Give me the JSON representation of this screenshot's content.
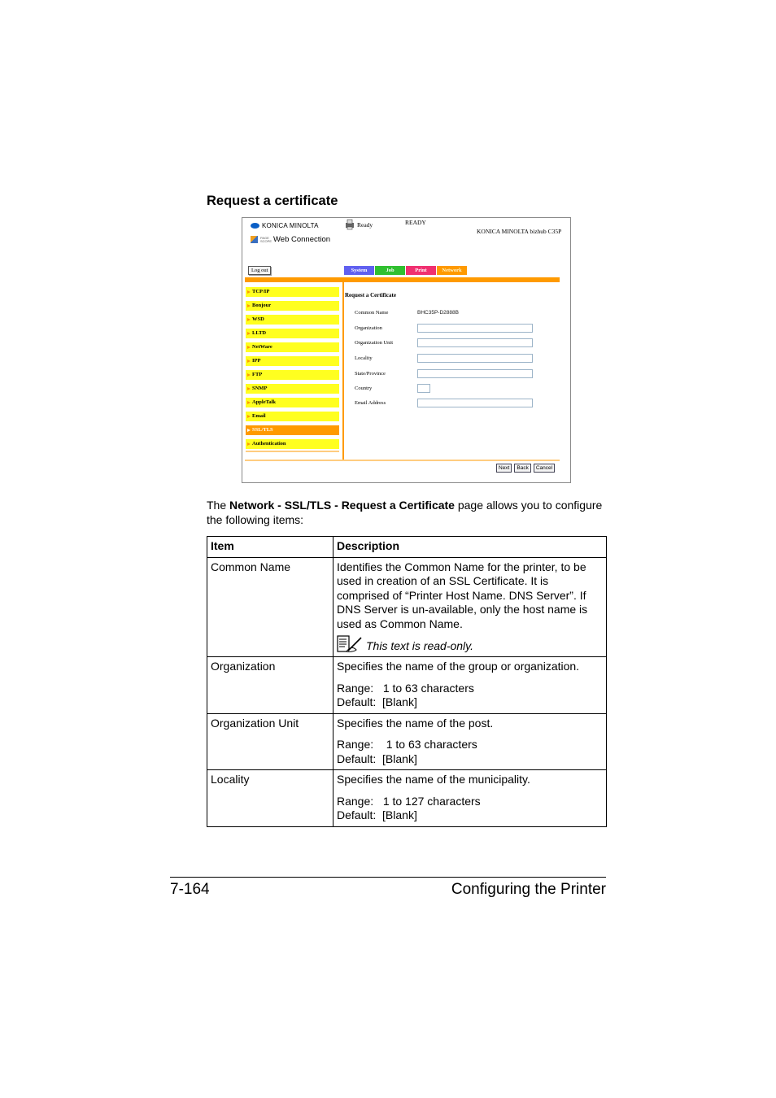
{
  "section_title": "Request a certificate",
  "screenshot": {
    "brand": "KONICA MINOLTA",
    "app_name": "Web Connection",
    "pagescope_label": "PAGE SCOPE",
    "status_label": "Ready",
    "status_value": "READY",
    "model_name": "KONICA MINOLTA bizhub C35P",
    "logout_label": "Log out",
    "tabs": [
      {
        "label": "System"
      },
      {
        "label": "Job"
      },
      {
        "label": "Print"
      },
      {
        "label": "Network"
      }
    ],
    "sidebar": [
      {
        "label": "TCP/IP"
      },
      {
        "label": "Bonjour"
      },
      {
        "label": "WSD"
      },
      {
        "label": "LLTD"
      },
      {
        "label": "NetWare"
      },
      {
        "label": "IPP"
      },
      {
        "label": "FTP"
      },
      {
        "label": "SNMP"
      },
      {
        "label": "AppleTalk"
      },
      {
        "label": "Email"
      },
      {
        "label": "SSL/TLS",
        "active": true
      },
      {
        "label": "Authentication"
      }
    ],
    "form": {
      "title": "Request a Certificate",
      "fields": [
        {
          "label": "Common Name",
          "value": "BHC35P-D2888B",
          "readonly": true
        },
        {
          "label": "Organization",
          "value": ""
        },
        {
          "label": "Organization Unit",
          "value": ""
        },
        {
          "label": "Locality",
          "value": ""
        },
        {
          "label": "State/Province",
          "value": ""
        },
        {
          "label": "Country",
          "value": ""
        },
        {
          "label": "Email Address",
          "value": ""
        }
      ]
    },
    "buttons": {
      "next": "Next",
      "back": "Back",
      "cancel": "Cancel"
    }
  },
  "intro": {
    "prefix": "The ",
    "bold": "Network - SSL/TLS - Request a Certificate",
    "suffix": " page allows you to configure the following items:"
  },
  "table": {
    "headers": [
      "Item",
      "Description"
    ],
    "rows": [
      {
        "item": "Common Name",
        "description": "Identifies the Common Name for the printer, to be used in creation of an SSL Certificate. It is comprised of “Printer Host Name. DNS Server”. If DNS Server is un-available, only the host name is used as Common Name.",
        "note": "This text is read-only."
      },
      {
        "item": "Organization",
        "description": "Specifies the name of the group or organization.",
        "range": "Range:   1 to 63 characters",
        "default": "Default:  [Blank]"
      },
      {
        "item": "Organization Unit",
        "description": "Specifies the name of the post.",
        "range": "Range:    1 to 63 characters",
        "default": "Default:  [Blank]"
      },
      {
        "item": "Locality",
        "description": "Specifies the name of the municipality.",
        "range": "Range:   1 to 127 characters",
        "default": "Default:  [Blank]"
      }
    ]
  },
  "footer": {
    "page_number": "7-164",
    "chapter_title": "Configuring the Printer"
  }
}
